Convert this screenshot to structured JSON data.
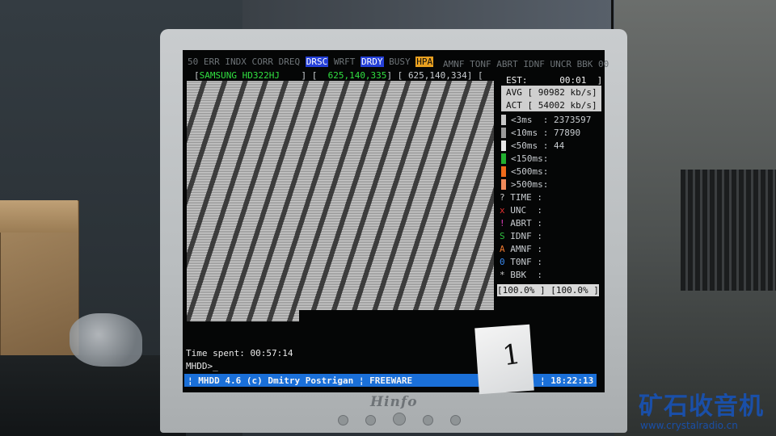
{
  "hdd": {
    "status_flags": [
      "50",
      "ERR",
      "INDX",
      "CORR",
      "DREQ",
      "DRSC",
      "WRFT",
      "DRDY",
      "BUSY",
      "HPA"
    ],
    "status_flags_right": [
      "AMNF",
      "TONF",
      "ABRT",
      "IDNF",
      "UNCR",
      "BBK",
      "00"
    ],
    "model": "SAMSUNG HD322HJ",
    "lba_current": "625,140,335",
    "lba_max": "625,140,334",
    "est_label": "EST:",
    "est_value": "00:01",
    "avg": "AVG [ 90982 kb/s]",
    "act": "ACT [ 54002 kb/s]",
    "timings": [
      {
        "label": "<3ms",
        "value": ": 2373597",
        "color": "#c8c8c8"
      },
      {
        "label": "<10ms",
        "value": ": 77890",
        "color": "#9a9a9a"
      },
      {
        "label": "<50ms",
        "value": ": 44",
        "color": "#e8e8e8"
      },
      {
        "label": "<150ms",
        "value": ":",
        "color": "#22b030"
      },
      {
        "label": "<500ms",
        "value": ":",
        "color": "#f06a1a"
      },
      {
        "label": ">500ms",
        "value": ":",
        "color": "#f08a5a"
      }
    ],
    "errors": [
      {
        "sym": "?",
        "label": "TIME",
        "sym_color": "#c8c8c8"
      },
      {
        "sym": "x",
        "label": "UNC",
        "sym_color": "#e03030"
      },
      {
        "sym": "!",
        "label": "ABRT",
        "sym_color": "#e040c0"
      },
      {
        "sym": "S",
        "label": "IDNF",
        "sym_color": "#30c040"
      },
      {
        "sym": "A",
        "label": "AMNF",
        "sym_color": "#f07a30"
      },
      {
        "sym": "0",
        "label": "T0NF",
        "sym_color": "#3a8af0"
      },
      {
        "sym": "*",
        "label": "BBK",
        "sym_color": "#c8c8c8"
      }
    ],
    "percent_left": "[100.0% ]",
    "percent_right": "[100.0% ]",
    "time_spent_label": "Time spent:",
    "time_spent": "00:57:14",
    "prompt": "MHDD>_",
    "statusbar_left": "¦ MHDD 4.6 (c) Dmitry Postrigan ¦ FREEWARE",
    "statusbar_right": "¦ 18:22:13",
    "colors": {
      "hl_blue": "#2540d8",
      "hl_orange": "#e8a020",
      "model_green": "#30e040",
      "status_blue": "#1a6fd8"
    }
  },
  "monitor_brand": "Hinfo",
  "sticker_text": "1",
  "watermark": {
    "title": "矿石收音机",
    "url": "www.crystalradio.cn"
  }
}
